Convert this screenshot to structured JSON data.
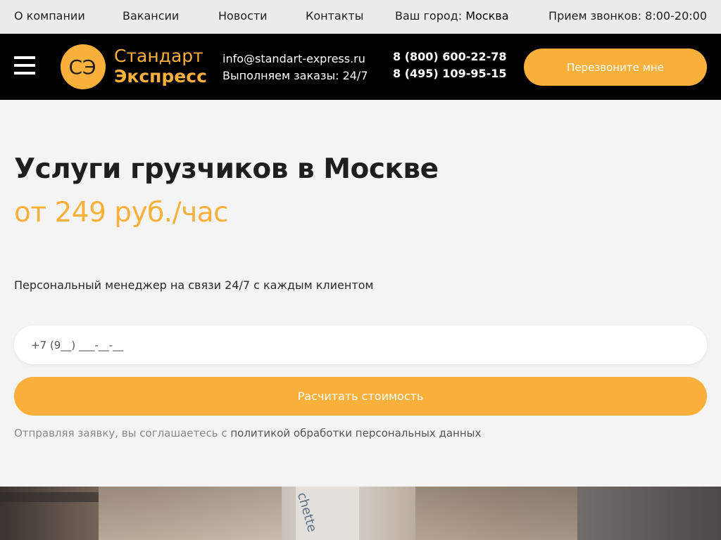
{
  "topbar": {
    "links": [
      "О компании",
      "Вакансии",
      "Новости",
      "Контакты"
    ],
    "city_label": "Ваш город:",
    "city_value": "Москва",
    "hours": "Прием звонков: 8:00-20:00"
  },
  "header": {
    "logo": {
      "line1": "Стандарт",
      "line2": "Экспресс",
      "mark_text": "СЭ"
    },
    "email": "info@standart-express.ru",
    "schedule": "Выполняем заказы: 24/7",
    "phone1": "8 (800) 600-22-78",
    "phone2": "8 (495) 109-95-15",
    "callback_label": "Перезвоните мне"
  },
  "hero": {
    "title": "Услуги грузчиков в Москве",
    "price": "от 249 руб./час",
    "subtitle": "Персональный менеджер на связи 24/7 с каждым клиентом",
    "phone_placeholder": "+7 (9__) ___-__-__",
    "submit_label": "Расчитать стоимость",
    "policy_text": "Отправляя заявку, вы соглашаетесь с ",
    "policy_link": "политикой обработки персональных данных"
  },
  "photo": {
    "tape_text": "chette"
  },
  "colors": {
    "accent": "#fbb03b",
    "header_bg": "#000000",
    "topbar_bg": "#ececec",
    "page_bg": "#f4f4f4"
  },
  "icons": {
    "menu": "hamburger-icon",
    "logo": "logo-icon"
  }
}
